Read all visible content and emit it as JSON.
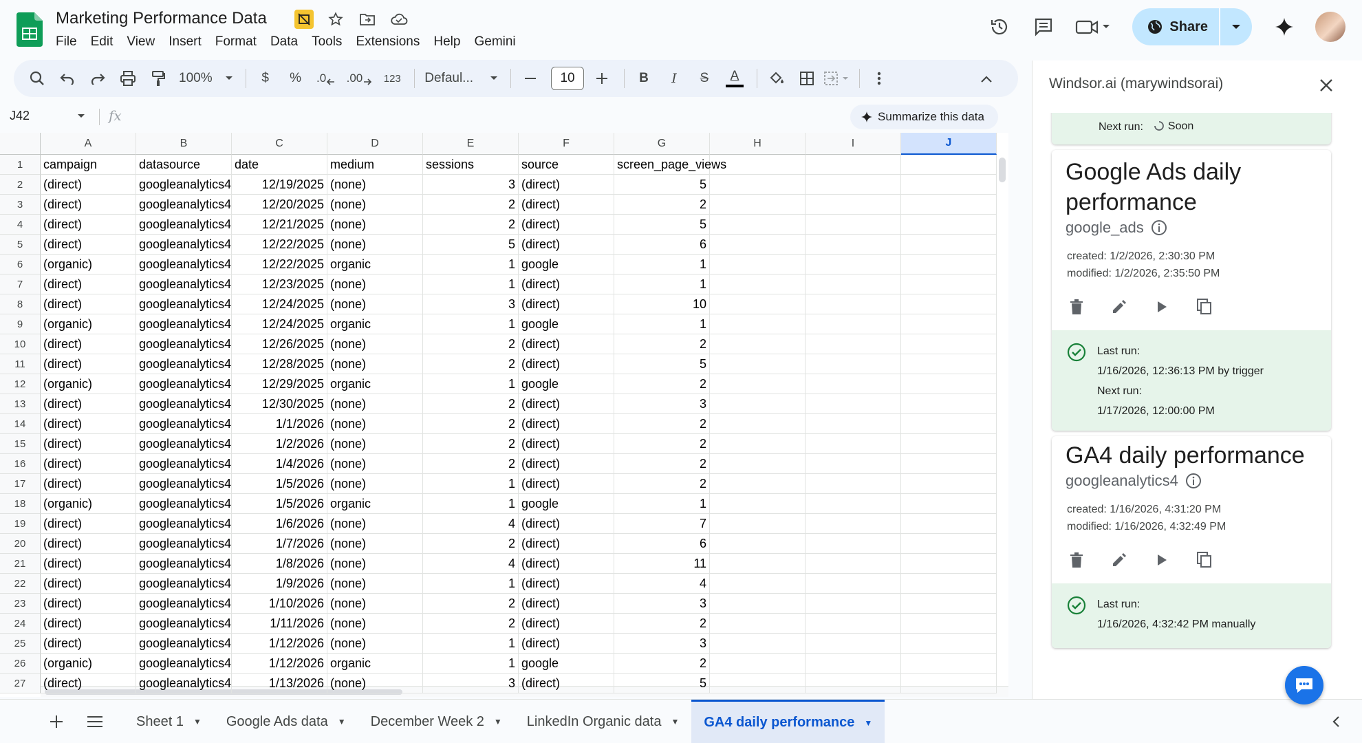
{
  "document": {
    "title": "Marketing Performance Data"
  },
  "menu": [
    "File",
    "Edit",
    "View",
    "Insert",
    "Format",
    "Data",
    "Tools",
    "Extensions",
    "Help",
    "Gemini"
  ],
  "header": {
    "share_label": "Share"
  },
  "toolbar": {
    "zoom": "100%",
    "currency": "$",
    "percent": "%",
    "dec_decrease": ".0",
    "dec_increase": ".00",
    "number_format": "123",
    "font": "Defaul...",
    "font_size": "10",
    "bold": "B",
    "italic": "I",
    "strike": "S",
    "text_color": "A"
  },
  "formula_bar": {
    "name_box": "J42",
    "fx": "fx",
    "summarize": "Summarize this data"
  },
  "grid": {
    "columns": [
      "A",
      "B",
      "C",
      "D",
      "E",
      "F",
      "G",
      "H",
      "I",
      "J"
    ],
    "selected_column": "J",
    "rows": [
      [
        "campaign",
        "datasource",
        "date",
        "medium",
        "sessions",
        "source",
        "screen_page_views"
      ],
      [
        "(direct)",
        "googleanalytics4",
        "12/19/2025",
        "(none)",
        "3",
        "(direct)",
        "5"
      ],
      [
        "(direct)",
        "googleanalytics4",
        "12/20/2025",
        "(none)",
        "2",
        "(direct)",
        "2"
      ],
      [
        "(direct)",
        "googleanalytics4",
        "12/21/2025",
        "(none)",
        "2",
        "(direct)",
        "5"
      ],
      [
        "(direct)",
        "googleanalytics4",
        "12/22/2025",
        "(none)",
        "5",
        "(direct)",
        "6"
      ],
      [
        "(organic)",
        "googleanalytics4",
        "12/22/2025",
        "organic",
        "1",
        "google",
        "1"
      ],
      [
        "(direct)",
        "googleanalytics4",
        "12/23/2025",
        "(none)",
        "1",
        "(direct)",
        "1"
      ],
      [
        "(direct)",
        "googleanalytics4",
        "12/24/2025",
        "(none)",
        "3",
        "(direct)",
        "10"
      ],
      [
        "(organic)",
        "googleanalytics4",
        "12/24/2025",
        "organic",
        "1",
        "google",
        "1"
      ],
      [
        "(direct)",
        "googleanalytics4",
        "12/26/2025",
        "(none)",
        "2",
        "(direct)",
        "2"
      ],
      [
        "(direct)",
        "googleanalytics4",
        "12/28/2025",
        "(none)",
        "2",
        "(direct)",
        "5"
      ],
      [
        "(organic)",
        "googleanalytics4",
        "12/29/2025",
        "organic",
        "1",
        "google",
        "2"
      ],
      [
        "(direct)",
        "googleanalytics4",
        "12/30/2025",
        "(none)",
        "2",
        "(direct)",
        "3"
      ],
      [
        "(direct)",
        "googleanalytics4",
        "1/1/2026",
        "(none)",
        "2",
        "(direct)",
        "2"
      ],
      [
        "(direct)",
        "googleanalytics4",
        "1/2/2026",
        "(none)",
        "2",
        "(direct)",
        "2"
      ],
      [
        "(direct)",
        "googleanalytics4",
        "1/4/2026",
        "(none)",
        "2",
        "(direct)",
        "2"
      ],
      [
        "(direct)",
        "googleanalytics4",
        "1/5/2026",
        "(none)",
        "1",
        "(direct)",
        "2"
      ],
      [
        "(organic)",
        "googleanalytics4",
        "1/5/2026",
        "organic",
        "1",
        "google",
        "1"
      ],
      [
        "(direct)",
        "googleanalytics4",
        "1/6/2026",
        "(none)",
        "4",
        "(direct)",
        "7"
      ],
      [
        "(direct)",
        "googleanalytics4",
        "1/7/2026",
        "(none)",
        "2",
        "(direct)",
        "6"
      ],
      [
        "(direct)",
        "googleanalytics4",
        "1/8/2026",
        "(none)",
        "4",
        "(direct)",
        "11"
      ],
      [
        "(direct)",
        "googleanalytics4",
        "1/9/2026",
        "(none)",
        "1",
        "(direct)",
        "4"
      ],
      [
        "(direct)",
        "googleanalytics4",
        "1/10/2026",
        "(none)",
        "2",
        "(direct)",
        "3"
      ],
      [
        "(direct)",
        "googleanalytics4",
        "1/11/2026",
        "(none)",
        "2",
        "(direct)",
        "2"
      ],
      [
        "(direct)",
        "googleanalytics4",
        "1/12/2026",
        "(none)",
        "1",
        "(direct)",
        "3"
      ],
      [
        "(organic)",
        "googleanalytics4",
        "1/12/2026",
        "organic",
        "1",
        "google",
        "2"
      ],
      [
        "(direct)",
        "googleanalytics4",
        "1/13/2026",
        "(none)",
        "3",
        "(direct)",
        "5"
      ]
    ]
  },
  "sheets": {
    "tabs": [
      "Sheet 1",
      "Google Ads data",
      "December Week 2",
      "LinkedIn Organic data",
      "GA4 daily performance"
    ],
    "active": "GA4 daily performance"
  },
  "panel": {
    "title": "Windsor.ai (marywindsorai)",
    "top_next_run_label": "Next run:",
    "top_next_run_value": "Soon",
    "cards": [
      {
        "name": "Google Ads daily performance",
        "source": "google_ads",
        "created": "created: 1/2/2026, 2:30:30 PM",
        "modified": "modified: 1/2/2026, 2:35:50 PM",
        "run_lines": [
          "Last run:",
          "1/16/2026, 12:36:13 PM by trigger",
          "Next run:",
          "1/17/2026, 12:00:00 PM"
        ]
      },
      {
        "name": "GA4 daily performance",
        "source": "googleanalytics4",
        "created": "created: 1/16/2026, 4:31:20 PM",
        "modified": "modified: 1/16/2026, 4:32:49 PM",
        "run_lines": [
          "Last run:",
          "1/16/2026, 4:32:42 PM manually"
        ]
      }
    ]
  },
  "colors": {
    "accent": "#0b57d0",
    "share_bg": "#c2e7ff",
    "sheets_green": "#0f9d58",
    "run_bg": "#e6f4ea",
    "check_green": "#188038"
  }
}
